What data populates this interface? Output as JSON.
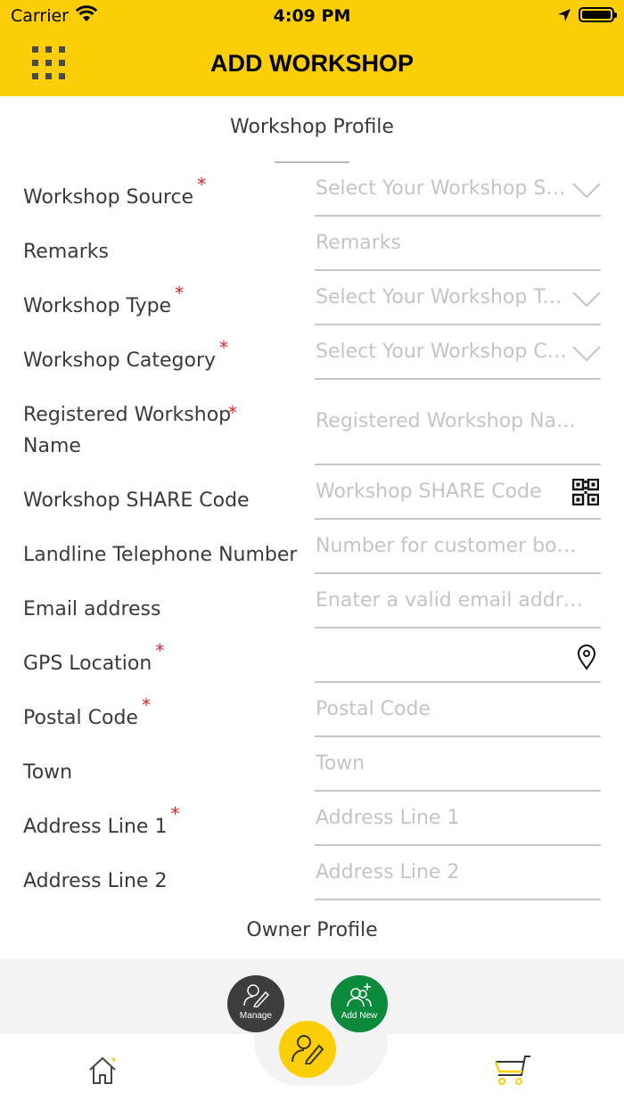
{
  "status_bar": {
    "carrier": "Carrier",
    "time": "4:09 PM"
  },
  "header": {
    "title": "ADD WORKSHOP",
    "background": "#fbce07"
  },
  "sections": {
    "workshop_profile": "Workshop Profile",
    "owner_profile": "Owner Profile"
  },
  "fields": [
    {
      "label": "Workshop Source",
      "required": "*",
      "placeholder": "Select Your Workshop So…",
      "icon": "chevron-down-icon"
    },
    {
      "label": "Remarks",
      "required": "",
      "placeholder": "Remarks",
      "icon": ""
    },
    {
      "label": "Workshop Type",
      "required": "*",
      "placeholder": "Select Your Workshop Type",
      "icon": "chevron-down-icon"
    },
    {
      "label": "Workshop Category",
      "required": "*",
      "placeholder": "Select Your Workshop Ca…",
      "icon": "chevron-down-icon"
    },
    {
      "label": "Registered Workshop Name",
      "required": "*",
      "placeholder": "Registered Workshop Na…",
      "icon": ""
    },
    {
      "label": "Workshop SHARE Code",
      "required": "",
      "placeholder": "Workshop SHARE Code",
      "icon": "qr-code-icon"
    },
    {
      "label": "Landline Telephone Number",
      "required": "",
      "placeholder": "Number for customer bo…",
      "icon": ""
    },
    {
      "label": "Email address",
      "required": "",
      "placeholder": "Enater a valid email addr…",
      "icon": ""
    },
    {
      "label": "GPS Location",
      "required": "*",
      "placeholder": "",
      "icon": "location-pin-icon"
    },
    {
      "label": "Postal Code",
      "required": "*",
      "placeholder": "Postal Code",
      "icon": ""
    },
    {
      "label": "Town",
      "required": "",
      "placeholder": "Town",
      "icon": ""
    },
    {
      "label": "Address Line 1",
      "required": "*",
      "placeholder": "Address Line 1",
      "icon": ""
    },
    {
      "label": "Address Line 2",
      "required": "",
      "placeholder": "Address Line 2",
      "icon": ""
    }
  ],
  "fab": {
    "manage": "Manage",
    "add_new": "Add New"
  },
  "colors": {
    "accent": "#fbce07",
    "required": "#d7262a",
    "manage_fab": "#3d3d3d",
    "add_new_fab": "#0c8a3c"
  }
}
